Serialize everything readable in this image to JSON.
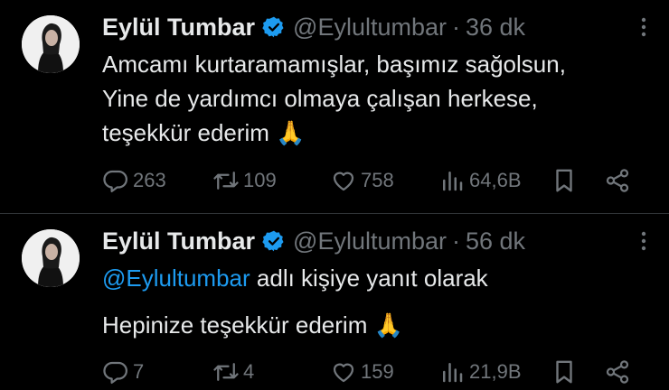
{
  "tweets": [
    {
      "name": "Eylül Tumbar",
      "handle": "@Eylultumbar",
      "separator": "·",
      "time": "36 dk",
      "lines": [
        "Amcamı kurtaramamışlar, başımız sağolsun,",
        "Yine de yardımcı olmaya çalışan herkese,",
        "teşekkür ederim 🙏"
      ],
      "replies": "263",
      "retweets": "109",
      "likes": "758",
      "views": "64,6B"
    },
    {
      "name": "Eylül Tumbar",
      "handle": "@Eylultumbar",
      "separator": "·",
      "time": "56 dk",
      "reply_mention": "@Eylultumbar",
      "reply_suffix": " adlı kişiye yanıt olarak",
      "lines": [
        "Hepinize teşekkür ederim 🙏"
      ],
      "replies": "7",
      "retweets": "4",
      "likes": "159",
      "views": "21,9B"
    }
  ],
  "colors": {
    "background": "#000000",
    "text": "#e7e9ea",
    "muted": "#71767b",
    "accent": "#1d9bf0",
    "divider": "#2f3336"
  },
  "icons": [
    "verified-badge-icon",
    "more-icon",
    "reply-icon",
    "retweet-icon",
    "like-icon",
    "views-icon",
    "bookmark-icon",
    "share-icon"
  ]
}
